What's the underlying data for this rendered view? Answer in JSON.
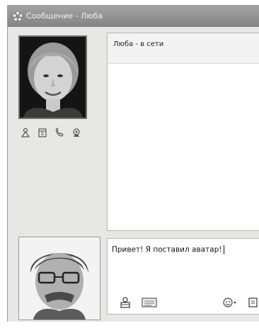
{
  "window": {
    "title": "Сообщение - Люба"
  },
  "conversation": {
    "status_text": "Люба - в сети"
  },
  "compose": {
    "text": "Привет! Я поставил аватар!"
  },
  "contact": {
    "avatar_label": "contact-photo"
  },
  "me": {
    "avatar_label": "my-photo"
  },
  "icons": {
    "title": "messenger-flower-icon",
    "actions": [
      "send-file-icon",
      "calendar-icon",
      "phone-icon",
      "webcam-icon"
    ],
    "toolbar": [
      "send-icon",
      "sms-icon",
      "emoticon-icon",
      "more-icon"
    ]
  },
  "colors": {
    "titlebar": "#8f8f8f",
    "panel": "#e7e7e4",
    "status_bg": "#f3f3f3"
  }
}
